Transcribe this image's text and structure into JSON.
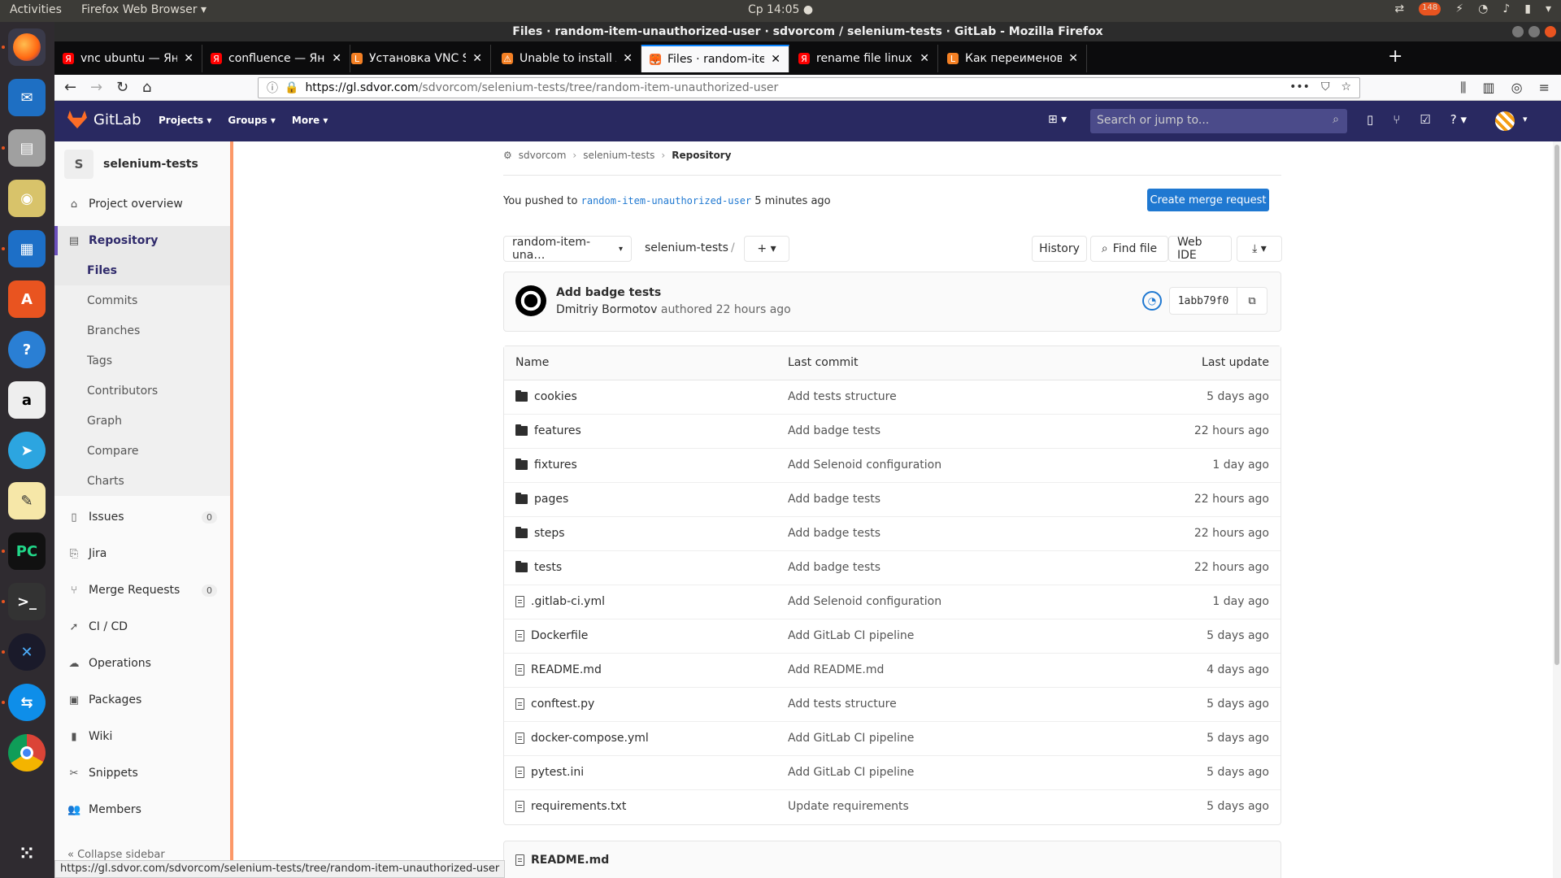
{
  "system": {
    "activities": "Activities",
    "app_name": "Firefox Web Browser ▾",
    "clock": "Ср 14:05 ●",
    "tray_badge": "148"
  },
  "window": {
    "title": "Files · random-item-unauthorized-user · sdvorcom / selenium-tests · GitLab - Mozilla Firefox"
  },
  "tabs": [
    {
      "title": "vnc ubuntu — Яндекс: на",
      "favicon_color": "#ff0000",
      "fav": "Я"
    },
    {
      "title": "confluence — Яндекс: на",
      "favicon_color": "#ff0000",
      "fav": "Я"
    },
    {
      "title": "Установка VNC Server в",
      "favicon_color": "#f48024",
      "fav": "L"
    },
    {
      "title": "Unable to install Allure C",
      "favicon_color": "#f48024",
      "fav": "⚠"
    },
    {
      "title": "Files · random-item-una",
      "favicon_color": "#fc6d26",
      "fav": "🦊",
      "active": true
    },
    {
      "title": "rename file linux — Янде",
      "favicon_color": "#ff0000",
      "fav": "Я"
    },
    {
      "title": "Как переименовать фай",
      "favicon_color": "#f48024",
      "fav": "L"
    }
  ],
  "url": {
    "host": "https://gl.sdvor.com",
    "path": "/sdvorcom/selenium-tests/tree/random-item-unauthorized-user"
  },
  "gitlab": {
    "logo_text": "GitLab",
    "menu": [
      "Projects ▾",
      "Groups ▾",
      "More ▾"
    ],
    "search_placeholder": "Search or jump to..."
  },
  "sidebar": {
    "project_initial": "S",
    "project_name": "selenium-tests",
    "items": {
      "overview": "Project overview",
      "repository": "Repository",
      "files": "Files",
      "commits": "Commits",
      "branches": "Branches",
      "tags": "Tags",
      "contributors": "Contributors",
      "graph": "Graph",
      "compare": "Compare",
      "charts": "Charts",
      "issues": "Issues",
      "issues_count": "0",
      "jira": "Jira",
      "merge_requests": "Merge Requests",
      "mr_count": "0",
      "cicd": "CI / CD",
      "operations": "Operations",
      "packages": "Packages",
      "wiki": "Wiki",
      "snippets": "Snippets",
      "members": "Members",
      "collapse": "Collapse sidebar"
    }
  },
  "breadcrumb": {
    "group": "sdvorcom",
    "project": "selenium-tests",
    "current": "Repository"
  },
  "push_notice": {
    "prefix": "You pushed to",
    "branch": "random-item-unauthorized-user",
    "suffix": "5 minutes ago",
    "button": "Create merge request"
  },
  "toolbar": {
    "branch": "random-item-una…",
    "path": "selenium-tests",
    "slash": "/",
    "add": "+ ▾",
    "history": "History",
    "find_file": "Find file",
    "web_ide": "Web IDE",
    "download": "⤓ ▾"
  },
  "last_commit": {
    "title": "Add badge tests",
    "author": "Dmitriy Bormotov",
    "authored": "authored 22 hours ago",
    "sha": "1abb79f0"
  },
  "tree": {
    "headers": {
      "name": "Name",
      "commit": "Last commit",
      "date": "Last update"
    },
    "rows": [
      {
        "name": "cookies",
        "type": "folder",
        "commit": "Add tests structure",
        "date": "5 days ago"
      },
      {
        "name": "features",
        "type": "folder",
        "commit": "Add badge tests",
        "date": "22 hours ago"
      },
      {
        "name": "fixtures",
        "type": "folder",
        "commit": "Add Selenoid configuration",
        "date": "1 day ago"
      },
      {
        "name": "pages",
        "type": "folder",
        "commit": "Add badge tests",
        "date": "22 hours ago"
      },
      {
        "name": "steps",
        "type": "folder",
        "commit": "Add badge tests",
        "date": "22 hours ago"
      },
      {
        "name": "tests",
        "type": "folder",
        "commit": "Add badge tests",
        "date": "22 hours ago"
      },
      {
        "name": ".gitlab-ci.yml",
        "type": "file",
        "commit": "Add Selenoid configuration",
        "date": "1 day ago"
      },
      {
        "name": "Dockerfile",
        "type": "file",
        "commit": "Add GitLab CI pipeline",
        "date": "5 days ago"
      },
      {
        "name": "README.md",
        "type": "file",
        "commit": "Add README.md",
        "date": "4 days ago"
      },
      {
        "name": "conftest.py",
        "type": "file",
        "commit": "Add tests structure",
        "date": "5 days ago"
      },
      {
        "name": "docker-compose.yml",
        "type": "file",
        "commit": "Add GitLab CI pipeline",
        "date": "5 days ago"
      },
      {
        "name": "pytest.ini",
        "type": "file",
        "commit": "Add GitLab CI pipeline",
        "date": "5 days ago"
      },
      {
        "name": "requirements.txt",
        "type": "file",
        "commit": "Update requirements",
        "date": "5 days ago"
      }
    ]
  },
  "readme_header": "README.md",
  "status_url": "https://gl.sdvor.com/sdvorcom/selenium-tests/tree/random-item-unauthorized-user",
  "colors": {
    "gitlab_header": "#292961",
    "accent_orange": "#fc6d26",
    "link_blue": "#1f78d1"
  }
}
